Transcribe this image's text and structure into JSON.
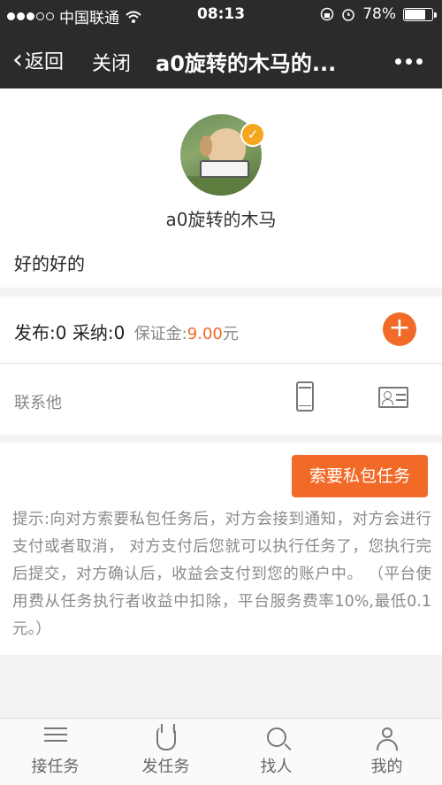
{
  "status_bar": {
    "carrier": "中国联通",
    "time": "08:13",
    "battery": "78%",
    "battery_level": 0.78
  },
  "nav": {
    "back_label": "返回",
    "close_label": "关闭",
    "title": "a0旋转的木马的..."
  },
  "profile": {
    "username": "a0旋转的木马",
    "bio": "好的好的",
    "verified": true
  },
  "stats": {
    "published_label": "发布:",
    "published": "0",
    "accepted_label": "采纳:",
    "accepted": "0",
    "deposit_label": "保证金:",
    "deposit_amount": "9.00",
    "deposit_unit": "元"
  },
  "contact": {
    "label": "联系他"
  },
  "private_task": {
    "button_label": "索要私包任务",
    "tip": "提示:向对方索要私包任务后，对方会接到通知，对方会进行支付或者取消， 对方支付后您就可以执行任务了，您执行完后提交，对方确认后，收益会支付到您的账户中。 （平台使用费从任务执行者收益中扣除，平台服务费率10%,最低0.1元。）"
  },
  "tabbar": {
    "items": [
      {
        "label": "接任务",
        "icon": "list-icon"
      },
      {
        "label": "发任务",
        "icon": "hand-icon"
      },
      {
        "label": "找人",
        "icon": "search-person-icon"
      },
      {
        "label": "我的",
        "icon": "user-icon"
      }
    ]
  },
  "colors": {
    "accent": "#f26a28",
    "nav_bg": "#2b2b2b",
    "verified_badge": "#f4a61c"
  }
}
